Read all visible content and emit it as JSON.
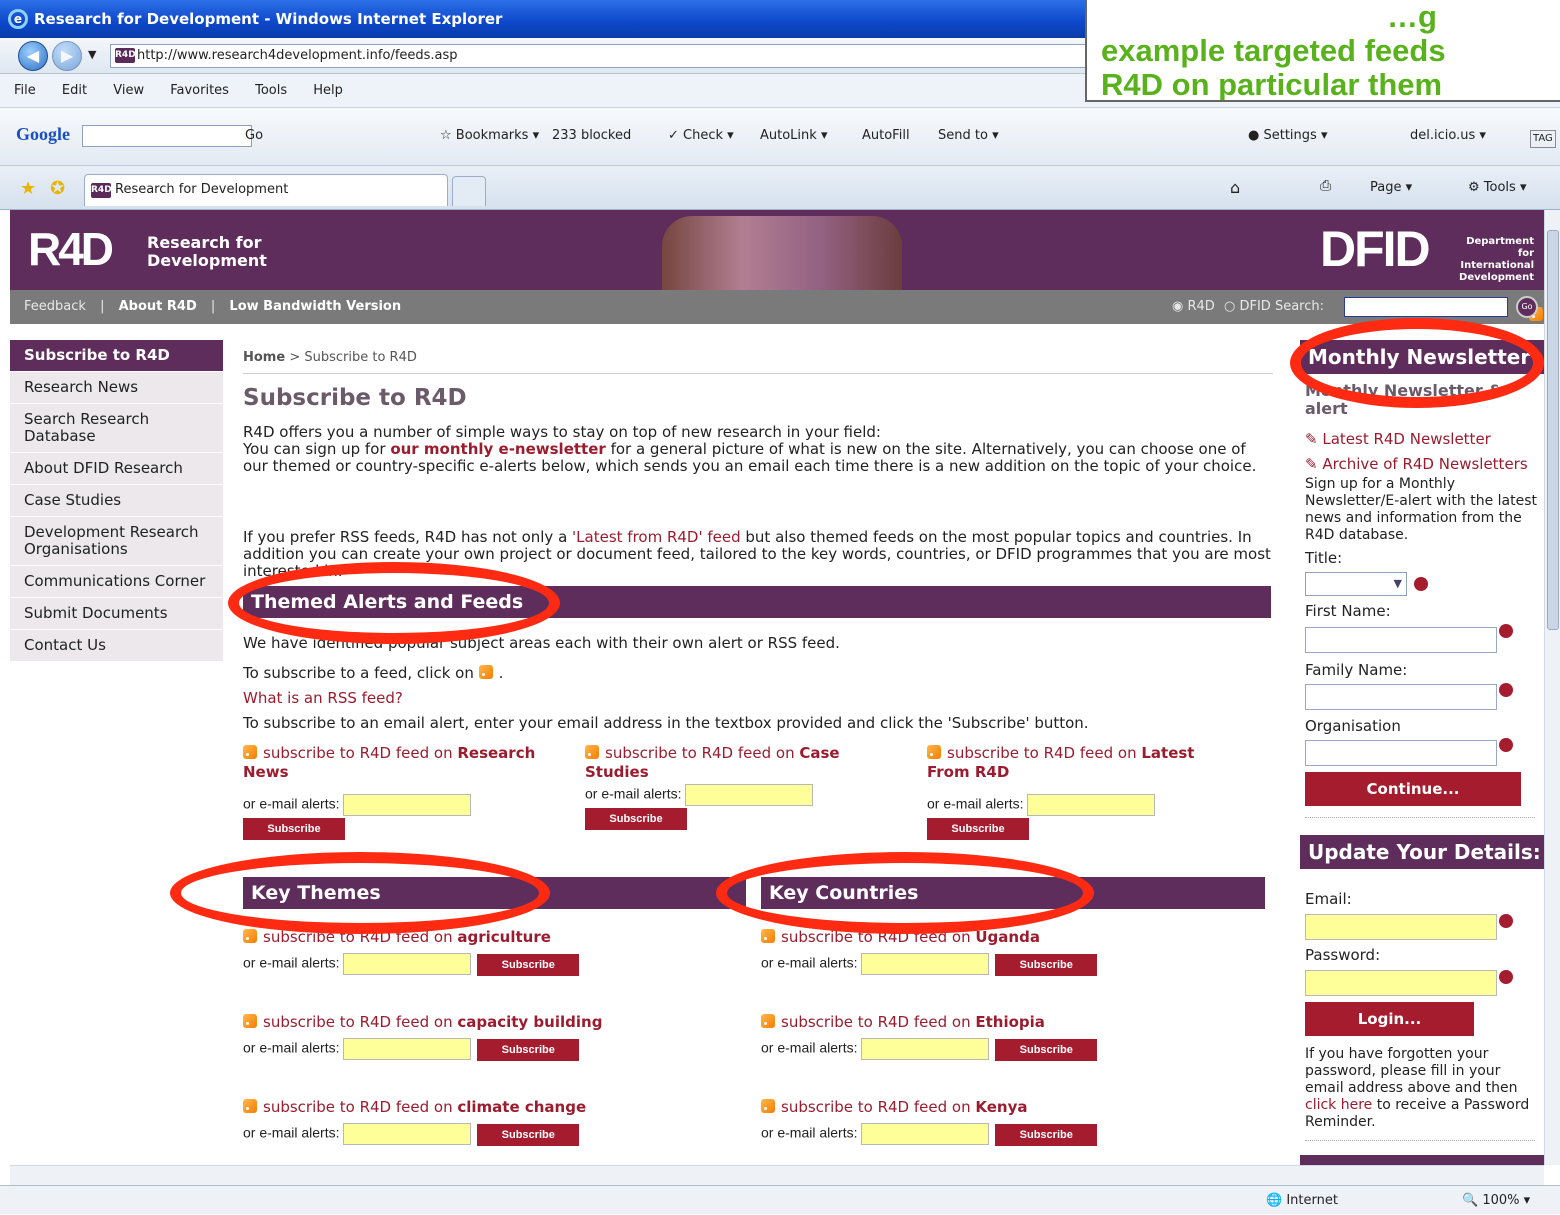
{
  "window": {
    "title": "Research for Development - Windows Internet Explorer"
  },
  "address": {
    "url": "http://www.research4development.info/feeds.asp"
  },
  "menu": [
    "File",
    "Edit",
    "View",
    "Favorites",
    "Tools",
    "Help"
  ],
  "google_toolbar": {
    "go": "Go",
    "bookmarks": "Bookmarks",
    "blocked": "233 blocked",
    "check": "Check",
    "autolink": "AutoLink",
    "autofill": "AutoFill",
    "sendto": "Send to",
    "settings": "Settings",
    "delicious": "del.icio.us",
    "tag": "TAG"
  },
  "tabs": {
    "tab1": "Research for Development",
    "page": "Page",
    "tools": "Tools"
  },
  "callout": {
    "line1": "…g",
    "line2": "example targeted feeds",
    "line3": "R4D on particular them"
  },
  "header": {
    "logo": "R4D",
    "logo_sub1": "Research for",
    "logo_sub2": "Development",
    "dfid": "DFID",
    "dfid_sub1": "Department for",
    "dfid_sub2": "International",
    "dfid_sub3": "Development"
  },
  "subnav": {
    "feedback": "Feedback",
    "about": "About R4D",
    "low": "Low Bandwidth Version",
    "r4d": "R4D",
    "dfid_search": "DFID Search:",
    "go": "Go"
  },
  "leftnav": [
    "Subscribe to R4D",
    "Research News",
    "Search Research Database",
    "About DFID Research",
    "Case Studies",
    "Development Research Organisations",
    "Communications Corner",
    "Submit Documents",
    "Contact Us"
  ],
  "main": {
    "breadcrumb_home": "Home",
    "breadcrumb_current": " > Subscribe to R4D",
    "title": "Subscribe to R4D",
    "intro1": "R4D offers you a number of simple ways to stay on top of new research in your field:",
    "intro2a": "You can sign up for ",
    "intro2link": "our monthly e-newsletter",
    "intro2b": " for a general picture of what is new on the site. Alternatively, you can choose one of our themed or country-specific e-alerts below, which sends you an email each time there is a new addition on the topic of your choice.",
    "rss1a": "If you prefer RSS feeds, R4D has not only a ",
    "rss1link": "'Latest from R4D' feed",
    "rss1b": " but also themed feeds on the most popular topics and countries. In addition you can create your own project or document feed, tailored to the key words, countries, or DFID programmes that you are most interested in.",
    "themed_heading": "Themed Alerts and Feeds",
    "themed_text": "We have identified popular subject areas each with their own alert or RSS feed.",
    "subscribe_click": "To subscribe to a feed, click on ",
    "what_rss": "What is an RSS feed?",
    "email_instr": "To subscribe to an email alert, enter your email address in the textbox provided and click the 'Subscribe' button.",
    "feed_prefix": "subscribe to R4D feed on ",
    "email_label": "or e-mail alerts: ",
    "subscribe_btn": "Subscribe",
    "top_feeds": [
      "Research News",
      "Case Studies",
      "Latest From R4D"
    ],
    "key_themes_heading": "Key Themes",
    "key_countries_heading": "Key Countries",
    "themes": [
      "agriculture",
      "capacity building",
      "climate change"
    ],
    "countries": [
      "Uganda",
      "Ethiopia",
      "Kenya"
    ]
  },
  "right": {
    "newsletter_heading": "Monthly Newsletter",
    "newsletter_sub": "Monthly Newsletter & alert",
    "latest": "Latest R4D Newsletter",
    "archive": "Archive of R4D Newsletters",
    "signup": "Sign up for a Monthly Newsletter/E-alert with the latest news and information from the R4D database.",
    "title_label": "Title:",
    "first_name": "First Name:",
    "family_name": "Family Name:",
    "organisation": "Organisation",
    "continue": "Continue...",
    "update_heading": "Update Your Details:",
    "email": "Email:",
    "password": "Password:",
    "login": "Login...",
    "forgot1": "If you have forgotten your password, please fill in your email address above and then ",
    "forgot_link": "click here",
    "forgot2": " to receive a Password Reminder."
  },
  "status": {
    "zone": "Internet",
    "zoom": "100%"
  }
}
